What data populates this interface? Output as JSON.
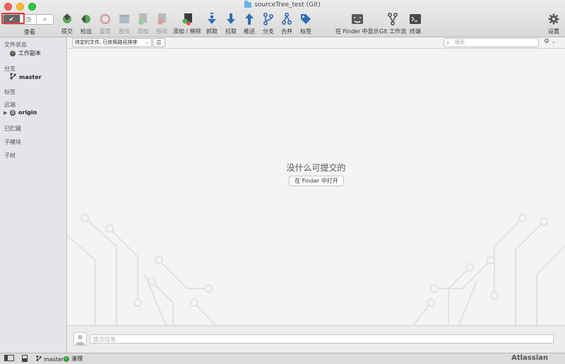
{
  "window": {
    "title": "sourceTree_test (Git)"
  },
  "view": {
    "label": "查看"
  },
  "toolbar": {
    "commit": "提交",
    "checkout": "检出",
    "reset": "重置",
    "stash": "暂存",
    "add": "添加",
    "remove": "移除",
    "add_remove": "添加 / 移除",
    "fetch": "抓取",
    "pull": "拉取",
    "push": "推送",
    "branch": "分支",
    "merge": "合并",
    "tag": "标签",
    "show_in_finder": "在 Finder 中显示",
    "git_flow": "Git 工作流",
    "terminal": "终端",
    "settings": "设置"
  },
  "sidebar": {
    "file_status": "文件状态",
    "working_copy": "工作副本",
    "branches": "分支",
    "master": "master",
    "tags": "标签",
    "remotes": "远端",
    "origin": "origin",
    "stashes": "已贮藏",
    "submodules": "子模块",
    "subtrees": "子树"
  },
  "filter": {
    "sort_value": "待定的文件, 已依照路径排序",
    "search_placeholder": "搜索"
  },
  "main": {
    "empty_message": "没什么可提交的",
    "open_in_finder": "在 Finder 中打开"
  },
  "commit": {
    "placeholder": "提交信息"
  },
  "status": {
    "branch": "master",
    "clean": "清理",
    "brand": "Atlassian"
  },
  "colors": {
    "accent_red": "#e23a3a",
    "green": "#2e9e3e",
    "blue": "#2f6db5"
  }
}
